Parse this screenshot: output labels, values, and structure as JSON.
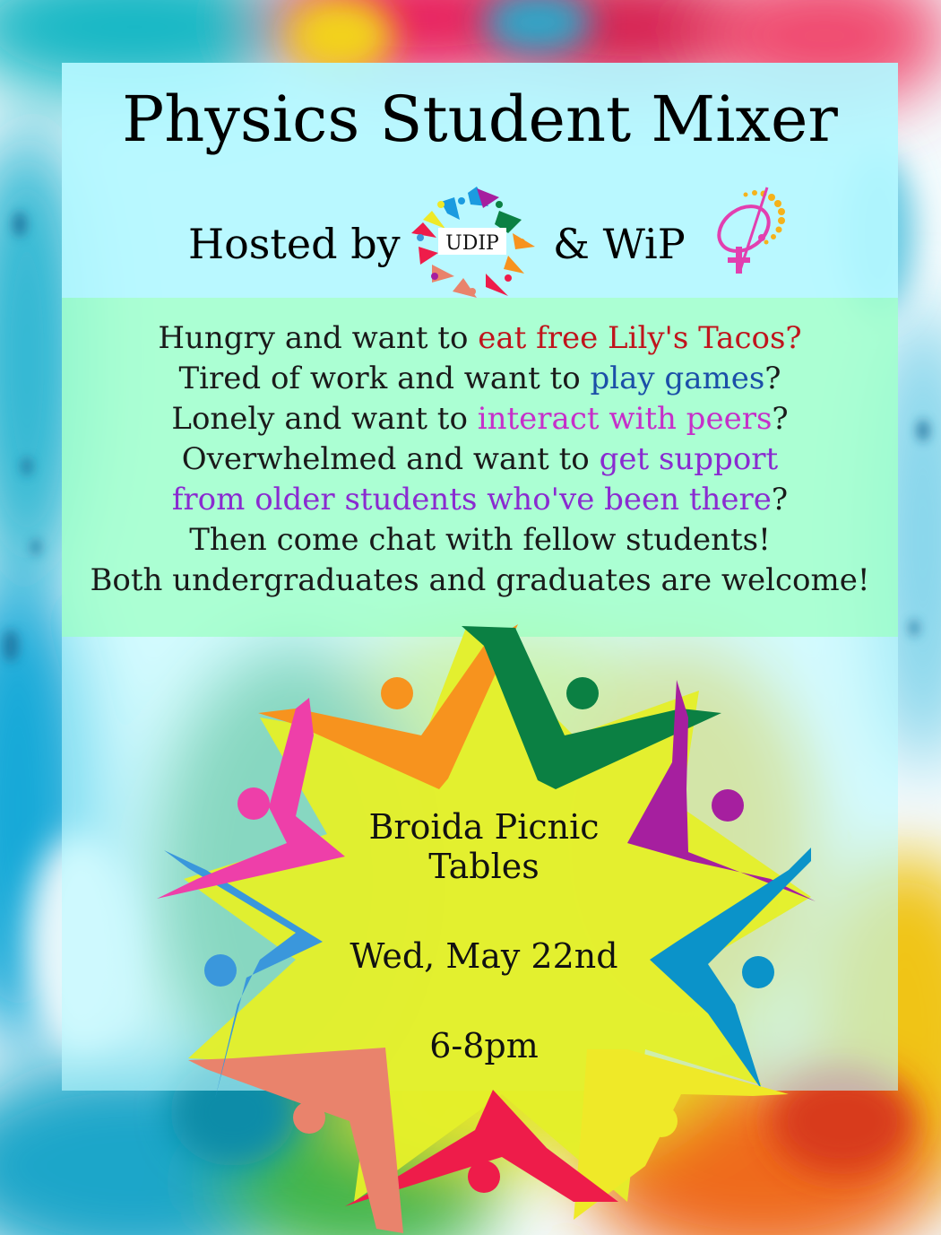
{
  "title": "Physics Student Mixer",
  "hosted": {
    "prefix": "Hosted by",
    "connector": "& WiP",
    "udip_logo_text": "UDIP",
    "udip_logo_icon": "udip-starburst-logo",
    "wip_logo_icon": "wip-venus-atom-logo"
  },
  "blurb": {
    "line1": {
      "a": "Hungry and want to ",
      "b": "eat free Lily's Tacos?"
    },
    "line2": {
      "a": "Tired of work and want to ",
      "b": "play games",
      "c": "?"
    },
    "line3": {
      "a": "Lonely and want to ",
      "b": "interact with peers",
      "c": "?"
    },
    "line4": {
      "a": "Overwhelmed and want to ",
      "b": "get support"
    },
    "line5": {
      "b": "from older students who've been there",
      "c": "?"
    },
    "line6": "Then come chat with fellow students!",
    "line7": "Both undergraduates and graduates are welcome!"
  },
  "event": {
    "location_line1": "Broida Picnic",
    "location_line2": "Tables",
    "date": "Wed, May 22nd",
    "time": "6-8pm"
  },
  "colors": {
    "highlight_red": "#c0141c",
    "highlight_blue": "#1b4fa8",
    "highlight_pink": "#c62fc9",
    "highlight_purple": "#8a2bd0",
    "star_center": "#e4ef2a",
    "figure_orange": "#f7931e",
    "figure_green": "#0b8043",
    "figure_purple": "#a61f9f",
    "figure_blue": "#0b93c9",
    "figure_yellow": "#efe928",
    "figure_red": "#ee1c4a",
    "figure_salmon": "#e9836c",
    "figure_lightblue": "#3a97dc",
    "figure_magenta": "#ee3fa9"
  }
}
